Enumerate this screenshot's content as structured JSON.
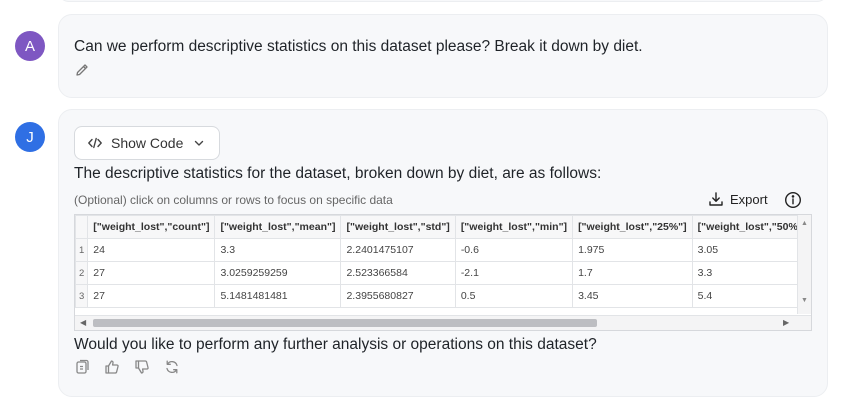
{
  "user": {
    "avatar_letter": "A",
    "message": "Can we perform descriptive statistics on this dataset please? Break it down by diet."
  },
  "assistant": {
    "avatar_letter": "J",
    "show_code_label": "Show Code",
    "description": "The descriptive statistics for the dataset, broken down by diet, are as follows:",
    "hint": "(Optional) click on columns or rows to focus on specific data",
    "export_label": "Export",
    "followup": "Would you like to perform any further analysis or operations on this dataset?"
  },
  "table": {
    "columns": [
      "[\"weight_lost\",\"count\"]",
      "[\"weight_lost\",\"mean\"]",
      "[\"weight_lost\",\"std\"]",
      "[\"weight_lost\",\"min\"]",
      "[\"weight_lost\",\"25%\"]",
      "[\"weight_lost\",\"50%\"]"
    ],
    "rows": [
      {
        "index": "1",
        "cells": [
          "24",
          "3.3",
          "2.2401475107",
          "-0.6",
          "1.975",
          "3.05"
        ]
      },
      {
        "index": "2",
        "cells": [
          "27",
          "3.0259259259",
          "2.523366584",
          "-2.1",
          "1.7",
          "3.3"
        ]
      },
      {
        "index": "3",
        "cells": [
          "27",
          "5.1481481481",
          "2.3955680827",
          "0.5",
          "3.45",
          "5.4"
        ]
      }
    ]
  },
  "colors": {
    "avatar_user": "#7e57c2",
    "avatar_assistant": "#2f6fe4",
    "bubble_bg": "#f7f8fa"
  }
}
